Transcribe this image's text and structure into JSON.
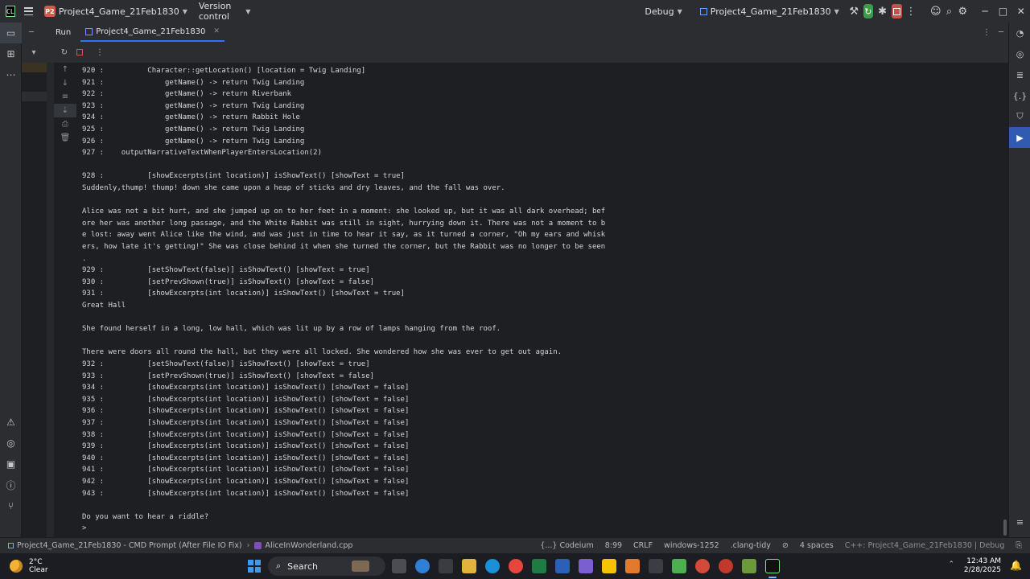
{
  "titlebar": {
    "project_badge": "P2",
    "project_name": "Project4_Game_21Feb1830",
    "vcs": "Version control",
    "config": "Debug",
    "run_target": "Project4_Game_21Feb1830"
  },
  "runbar": {
    "run_label": "Run",
    "tab_name": "Project4_Game_21Feb1830"
  },
  "console": {
    "lines": [
      "920 :          Character::getLocation() [location = Twig Landing]",
      "921 :              getName() -> return Twig Landing",
      "922 :              getName() -> return Riverbank",
      "923 :              getName() -> return Twig Landing",
      "924 :              getName() -> return Rabbit Hole",
      "925 :              getName() -> return Twig Landing",
      "926 :              getName() -> return Twig Landing",
      "927 :    outputNarrativeTextWhenPlayerEntersLocation(2)",
      "",
      "928 :          [showExcerpts(int location)] isShowText() [showText = true]",
      "Suddenly,thump! thump! down she came upon a heap of sticks and dry leaves, and the fall was over.",
      "",
      "Alice was not a bit hurt, and she jumped up on to her feet in a moment: she looked up, but it was all dark overhead; bef",
      "ore her was another long passage, and the White Rabbit was still in sight, hurrying down it. There was not a moment to b",
      "e lost: away went Alice like the wind, and was just in time to hear it say, as it turned a corner, \"Oh my ears and whisk",
      "ers, how late it's getting!\" She was close behind it when she turned the corner, but the Rabbit was no longer to be seen",
      ".",
      "929 :          [setShowText(false)] isShowText() [showText = true]",
      "930 :          [setPrevShown(true)] isShowText() [showText = false]",
      "931 :          [showExcerpts(int location)] isShowText() [showText = true]",
      "Great Hall",
      "",
      "She found herself in a long, low hall, which was lit up by a row of lamps hanging from the roof.",
      "",
      "There were doors all round the hall, but they were all locked. She wondered how she was ever to get out again.",
      "932 :          [setShowText(false)] isShowText() [showText = true]",
      "933 :          [setPrevShown(true)] isShowText() [showText = false]",
      "934 :          [showExcerpts(int location)] isShowText() [showText = false]",
      "935 :          [showExcerpts(int location)] isShowText() [showText = false]",
      "936 :          [showExcerpts(int location)] isShowText() [showText = false]",
      "937 :          [showExcerpts(int location)] isShowText() [showText = false]",
      "938 :          [showExcerpts(int location)] isShowText() [showText = false]",
      "939 :          [showExcerpts(int location)] isShowText() [showText = false]",
      "940 :          [showExcerpts(int location)] isShowText() [showText = false]",
      "941 :          [showExcerpts(int location)] isShowText() [showText = false]",
      "942 :          [showExcerpts(int location)] isShowText() [showText = false]",
      "943 :          [showExcerpts(int location)] isShowText() [showText = false]",
      "",
      "Do you want to hear a riddle?",
      ">"
    ]
  },
  "statusbar": {
    "crumb_project": "Project4_Game_21Feb1830 - CMD Prompt (After File IO Fix)",
    "crumb_file": "AliceInWonderland.cpp",
    "codeium": "{...} Codeium",
    "position": "8:99",
    "line_ending": "CRLF",
    "encoding": "windows-1252",
    "linter": ".clang-tidy",
    "indent": "4 spaces",
    "context": "C++: Project4_Game_21Feb1830 | Debug"
  },
  "taskbar": {
    "temperature": "2°C",
    "weather": "Clear",
    "search_label": "Search",
    "time": "12:43 AM",
    "date": "2/28/2025"
  },
  "colors": {
    "accent": "#3574f0",
    "background": "#1e1f22",
    "panel": "#2b2d30",
    "console_text": "#d4d6da"
  }
}
